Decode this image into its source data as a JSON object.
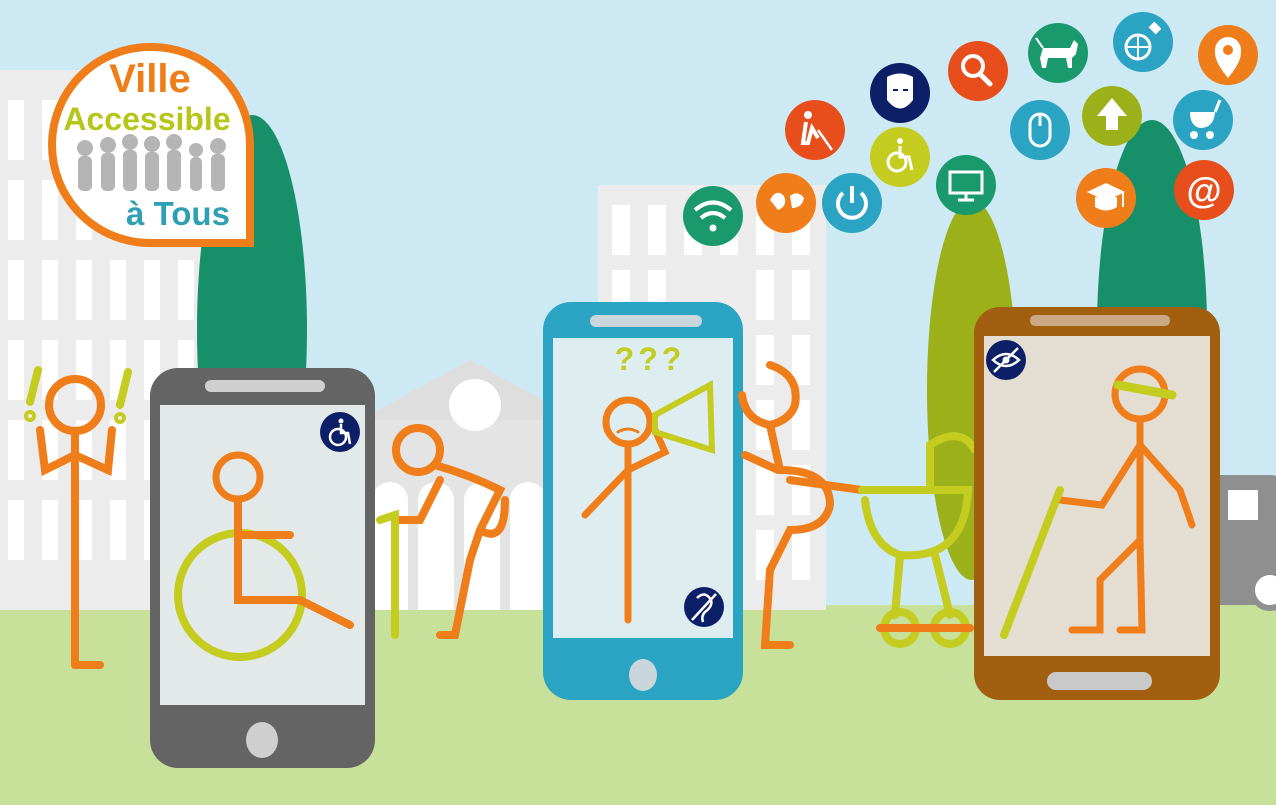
{
  "logo": {
    "line1": "Ville",
    "line2": "Accessible",
    "line3": "à Tous",
    "colors": {
      "line1": "#ef7d1a",
      "line2": "#b5c619",
      "line3": "#2f9fb3",
      "ring": "#ef7d1a"
    }
  },
  "colors": {
    "sky": "#cde9f4",
    "grass": "#c7e09a",
    "buildings": "#ececec",
    "tree_dark": "#179069",
    "tree_light": "#9cb01a",
    "figure_orange": "#ef7d1a",
    "figure_lime": "#c3cc1f",
    "phone_gray": "#646464",
    "phone_blue": "#2ba3c2",
    "phone_brown": "#a25f10",
    "badge_navy": "#0d1f66"
  },
  "icons": [
    {
      "name": "wifi-icon",
      "color": "#1a9a6c"
    },
    {
      "name": "sign-language-icon",
      "color": "#ef7d1a"
    },
    {
      "name": "power-icon",
      "color": "#2ba3c2"
    },
    {
      "name": "blind-person-cane-icon",
      "color": "#e84e1b"
    },
    {
      "name": "face-mask-icon",
      "color": "#0d1f66"
    },
    {
      "name": "wheelchair-icon",
      "color": "#c3cc1f"
    },
    {
      "name": "search-icon",
      "color": "#e84e1b"
    },
    {
      "name": "monitor-icon",
      "color": "#1a9a6c"
    },
    {
      "name": "guide-dog-icon",
      "color": "#1a9a6c"
    },
    {
      "name": "mouse-icon",
      "color": "#2ba3c2"
    },
    {
      "name": "up-arrow-icon",
      "color": "#9cb01a"
    },
    {
      "name": "satellite-globe-icon",
      "color": "#2ba3c2"
    },
    {
      "name": "graduation-cap-icon",
      "color": "#ef7d1a"
    },
    {
      "name": "location-pin-icon",
      "color": "#ef7d1a"
    },
    {
      "name": "stroller-icon",
      "color": "#2ba3c2"
    },
    {
      "name": "at-sign-icon",
      "color": "#e84e1b"
    }
  ],
  "phone_badges": [
    "wheelchair-badge-icon",
    "hearing-impaired-badge-icon",
    "low-vision-badge-icon"
  ],
  "question_marks": "???",
  "at_symbol": "@"
}
